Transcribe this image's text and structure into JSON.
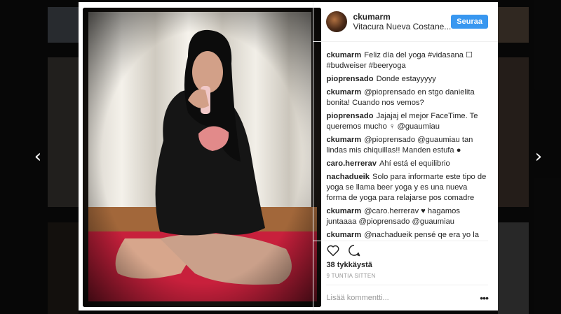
{
  "post": {
    "username": "ckumarm",
    "location": "Vitacura Nueva Costane...",
    "follow_label": "Seuraa",
    "likes": "38 tykkäystä",
    "timestamp": "9 TUNTIA SITTEN",
    "comment_placeholder": "Lisää kommentti...",
    "more_label": "•••"
  },
  "comments": [
    {
      "user": "ckumarm",
      "text": "Feliz día del yoga #vidasana ☐ #budweiser #beeryoga"
    },
    {
      "user": "pioprensado",
      "text": "Donde estayyyyy"
    },
    {
      "user": "ckumarm",
      "text": "@pioprensado en stgo danielita bonita! Cuando nos vemos?"
    },
    {
      "user": "pioprensado",
      "text": "Jajajaj el mejor FaceTime. Te queremos mucho ♀ @guaumiau"
    },
    {
      "user": "ckumarm",
      "text": "@pioprensado @guaumiau tan lindas mis chiquillas!! Manden estufa ●"
    },
    {
      "user": "caro.herrerav",
      "text": "Ahí está el equilibrio"
    },
    {
      "user": "nachadueik",
      "text": "Solo para informarte este tipo de yoga se llama beer yoga y es una nueva forma de yoga para relajarse pos comadre"
    },
    {
      "user": "ckumarm",
      "text": "@caro.herrerav ♥ hagamos juntaaaa @pioprensado @guaumiau"
    },
    {
      "user": "ckumarm",
      "text": "@nachadueik pensé qe era yo la qe innovaba ☐☐☐♀"
    }
  ],
  "nav": {
    "prev": "‹",
    "next": "›"
  },
  "icons": {
    "like": "heart-icon",
    "comment": "comment-bubble-icon",
    "prev": "chevron-left-icon",
    "next": "chevron-right-icon"
  },
  "colors": {
    "accent": "#3897f0",
    "mat": "#c8203c"
  }
}
